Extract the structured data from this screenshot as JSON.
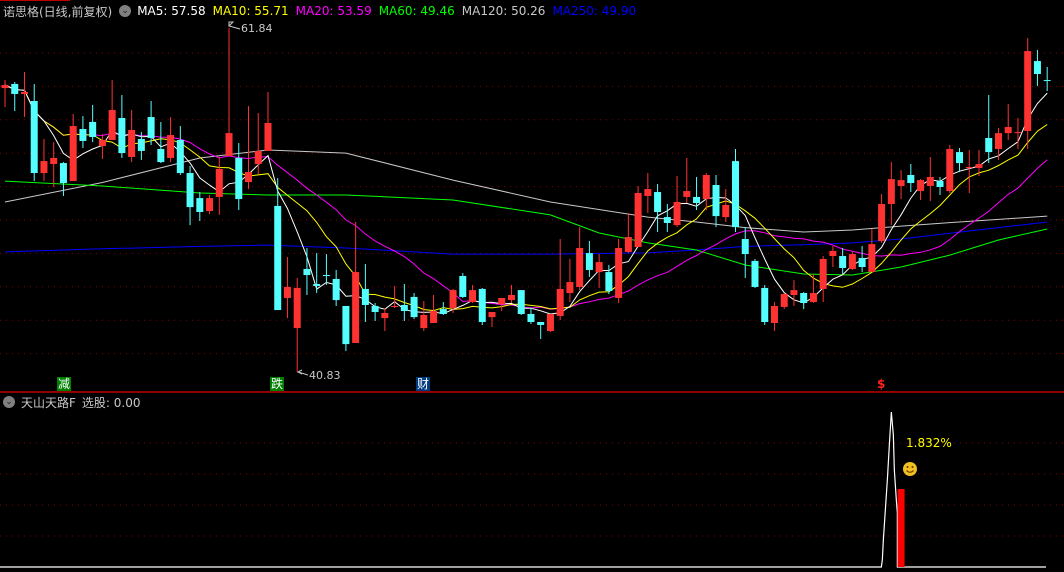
{
  "header": {
    "title": "诺思格(日线,前复权)",
    "ma": [
      {
        "label": "MA5: 57.58",
        "color": "#ffffff"
      },
      {
        "label": "MA10: 55.71",
        "color": "#ffff00"
      },
      {
        "label": "MA20: 53.59",
        "color": "#ff00ff"
      },
      {
        "label": "MA60: 49.46",
        "color": "#00ff00"
      },
      {
        "label": "MA120: 50.26",
        "color": "#c8c8c8"
      },
      {
        "label": "MA250: 49.90",
        "color": "#0000ff"
      }
    ]
  },
  "indicator": {
    "name": "天山天路F",
    "value_label": "选股: 0.00",
    "pct_label": "1.832%",
    "smiley": "smiley-icon"
  },
  "markers": [
    {
      "text": "减",
      "bg": "#008000"
    },
    {
      "text": "跌",
      "bg": "#008000"
    },
    {
      "text": "财",
      "bg": "#003a80"
    },
    {
      "text": "$",
      "color": "#ff2020"
    }
  ],
  "colors": {
    "up": "#ff3232",
    "down": "#54ffff",
    "grid": "#8b0000",
    "separator": "#c00000"
  },
  "chart_data": {
    "type": "candlestick",
    "title": "诺思格(日线,前复权)",
    "ylim": [
      40.0,
      62.5
    ],
    "annotations": [
      {
        "label": "61.84",
        "candle": 23,
        "type": "high"
      },
      {
        "label": "40.83",
        "candle": 30,
        "type": "low"
      }
    ],
    "ohlc": [
      [
        58.17,
        58.66,
        57.01,
        58.36
      ],
      [
        58.42,
        58.54,
        56.77,
        57.81
      ],
      [
        57.81,
        59.15,
        56.4,
        57.93
      ],
      [
        57.38,
        58.42,
        52.49,
        52.98
      ],
      [
        52.98,
        55.06,
        52.49,
        53.71
      ],
      [
        53.53,
        54.87,
        52.13,
        53.9
      ],
      [
        53.59,
        53.65,
        51.58,
        52.37
      ],
      [
        52.49,
        56.59,
        52.49,
        55.85
      ],
      [
        55.67,
        56.46,
        54.51,
        54.94
      ],
      [
        56.1,
        57.14,
        54.87,
        55.18
      ],
      [
        54.63,
        55.36,
        53.84,
        55.0
      ],
      [
        55.0,
        58.66,
        55.0,
        56.83
      ],
      [
        56.34,
        57.75,
        53.9,
        54.2
      ],
      [
        53.96,
        56.83,
        53.65,
        55.61
      ],
      [
        55.06,
        55.49,
        53.78,
        54.33
      ],
      [
        56.4,
        57.38,
        54.69,
        55.12
      ],
      [
        54.45,
        56.1,
        53.59,
        53.65
      ],
      [
        53.9,
        56.4,
        53.65,
        55.3
      ],
      [
        55.0,
        55.85,
        52.86,
        52.98
      ],
      [
        52.98,
        53.41,
        49.8,
        50.9
      ],
      [
        51.45,
        51.82,
        50.05,
        50.6
      ],
      [
        50.66,
        51.64,
        50.48,
        51.45
      ],
      [
        51.52,
        53.96,
        50.42,
        53.23
      ],
      [
        54.02,
        61.84,
        54.02,
        55.42
      ],
      [
        53.9,
        54.81,
        50.72,
        51.39
      ],
      [
        52.43,
        57.07,
        52.0,
        53.04
      ],
      [
        53.53,
        56.65,
        52.92,
        54.33
      ],
      [
        54.33,
        57.93,
        54.33,
        56.04
      ],
      [
        50.97,
        52.68,
        44.61,
        44.61
      ],
      [
        45.35,
        47.85,
        44.12,
        46.02
      ],
      [
        43.51,
        46.57,
        40.83,
        45.96
      ],
      [
        47.12,
        48.4,
        45.53,
        46.75
      ],
      [
        46.2,
        48.09,
        45.65,
        46.08
      ],
      [
        46.75,
        48.03,
        46.14,
        46.69
      ],
      [
        46.51,
        47.06,
        44.86,
        45.22
      ],
      [
        44.86,
        44.86,
        42.11,
        42.53
      ],
      [
        42.6,
        49.99,
        42.6,
        46.93
      ],
      [
        45.9,
        47.42,
        43.88,
        44.92
      ],
      [
        44.86,
        45.04,
        43.94,
        44.49
      ],
      [
        44.12,
        44.73,
        43.33,
        44.43
      ],
      [
        44.8,
        46.08,
        44.73,
        44.86
      ],
      [
        44.92,
        46.2,
        43.94,
        44.55
      ],
      [
        45.41,
        45.65,
        44.06,
        44.18
      ],
      [
        43.51,
        45.16,
        43.33,
        44.31
      ],
      [
        43.82,
        45.53,
        43.82,
        44.55
      ],
      [
        44.67,
        45.1,
        44.31,
        44.37
      ],
      [
        44.73,
        45.9,
        44.43,
        45.83
      ],
      [
        46.69,
        46.87,
        45.35,
        45.41
      ],
      [
        45.1,
        46.14,
        45.04,
        45.83
      ],
      [
        45.9,
        45.96,
        43.7,
        43.88
      ],
      [
        44.18,
        44.49,
        43.57,
        44.49
      ],
      [
        44.98,
        45.35,
        44.55,
        45.35
      ],
      [
        45.22,
        46.14,
        45.04,
        45.53
      ],
      [
        45.83,
        45.83,
        44.31,
        44.37
      ],
      [
        44.37,
        44.73,
        43.76,
        43.88
      ],
      [
        43.88,
        43.88,
        42.84,
        43.7
      ],
      [
        43.33,
        43.57,
        43.27,
        44.37
      ],
      [
        44.25,
        48.95,
        44.0,
        45.9
      ],
      [
        45.65,
        47.73,
        45.1,
        46.32
      ],
      [
        46.02,
        49.68,
        45.83,
        48.4
      ],
      [
        48.09,
        48.83,
        46.63,
        47.06
      ],
      [
        46.93,
        48.03,
        45.96,
        47.54
      ],
      [
        46.93,
        47.36,
        45.59,
        45.77
      ],
      [
        45.35,
        48.95,
        45.04,
        48.4
      ],
      [
        48.16,
        50.54,
        48.09,
        49.07
      ],
      [
        48.46,
        52.19,
        48.46,
        51.76
      ],
      [
        51.58,
        52.98,
        50.54,
        52.0
      ],
      [
        51.82,
        52.31,
        49.38,
        50.6
      ],
      [
        50.29,
        51.09,
        49.38,
        49.93
      ],
      [
        49.8,
        52.8,
        49.68,
        51.21
      ],
      [
        51.52,
        53.9,
        51.15,
        51.88
      ],
      [
        51.52,
        52.74,
        50.72,
        51.15
      ],
      [
        51.39,
        52.98,
        50.72,
        52.86
      ],
      [
        52.25,
        52.86,
        49.68,
        50.35
      ],
      [
        50.29,
        52.0,
        49.99,
        51.03
      ],
      [
        53.71,
        54.45,
        49.38,
        49.68
      ],
      [
        48.95,
        49.68,
        46.57,
        48.03
      ],
      [
        47.61,
        47.73,
        45.96,
        46.02
      ],
      [
        45.96,
        46.14,
        43.7,
        43.88
      ],
      [
        43.82,
        45.1,
        43.33,
        44.86
      ],
      [
        44.8,
        45.65,
        44.67,
        45.59
      ],
      [
        45.53,
        46.44,
        44.86,
        45.83
      ],
      [
        45.65,
        45.71,
        44.67,
        45.04
      ],
      [
        45.1,
        46.81,
        45.04,
        45.65
      ],
      [
        45.9,
        47.91,
        45.1,
        47.73
      ],
      [
        47.91,
        48.52,
        47.24,
        48.22
      ],
      [
        47.91,
        48.4,
        46.81,
        47.18
      ],
      [
        47.12,
        48.16,
        47.06,
        48.03
      ],
      [
        47.79,
        48.52,
        46.93,
        47.24
      ],
      [
        46.93,
        49.56,
        46.93,
        48.64
      ],
      [
        48.83,
        51.7,
        48.71,
        51.09
      ],
      [
        51.09,
        53.65,
        49.8,
        52.61
      ],
      [
        52.19,
        53.16,
        51.39,
        52.55
      ],
      [
        52.86,
        53.53,
        51.82,
        52.37
      ],
      [
        51.88,
        52.61,
        51.33,
        52.55
      ],
      [
        52.19,
        53.96,
        51.27,
        52.74
      ],
      [
        52.49,
        52.74,
        51.64,
        52.13
      ],
      [
        51.88,
        54.69,
        51.76,
        54.45
      ],
      [
        54.26,
        54.51,
        53.04,
        53.59
      ],
      [
        53.29,
        54.39,
        51.76,
        53.35
      ],
      [
        53.29,
        54.39,
        52.8,
        53.53
      ],
      [
        55.12,
        57.75,
        53.59,
        54.26
      ],
      [
        54.45,
        55.73,
        53.78,
        55.42
      ],
      [
        55.42,
        57.2,
        55.0,
        55.79
      ],
      [
        55.42,
        56.34,
        54.45,
        55.48
      ],
      [
        55.55,
        61.23,
        54.45,
        60.43
      ],
      [
        59.82,
        60.5,
        58.3,
        59.03
      ],
      [
        58.66,
        59.46,
        57.99,
        58.6
      ]
    ],
    "long_ma": {
      "MA60": [
        [
          0,
          52.49
        ],
        [
          10,
          52.19
        ],
        [
          20,
          51.76
        ],
        [
          27,
          51.64
        ],
        [
          35,
          51.64
        ],
        [
          46,
          51.33
        ],
        [
          56,
          50.42
        ],
        [
          61,
          49.32
        ],
        [
          66,
          48.71
        ],
        [
          71,
          48.28
        ],
        [
          76,
          47.36
        ],
        [
          82,
          46.81
        ],
        [
          87,
          46.75
        ],
        [
          92,
          47.24
        ],
        [
          97,
          47.97
        ],
        [
          102,
          48.89
        ],
        [
          107,
          49.56
        ]
      ],
      "MA120": [
        [
          0,
          51.21
        ],
        [
          10,
          52.4
        ],
        [
          20,
          53.9
        ],
        [
          27,
          54.39
        ],
        [
          35,
          54.2
        ],
        [
          46,
          52.55
        ],
        [
          56,
          51.21
        ],
        [
          66,
          50.29
        ],
        [
          71,
          49.99
        ],
        [
          76,
          49.65
        ],
        [
          82,
          49.38
        ],
        [
          87,
          49.5
        ],
        [
          92,
          49.74
        ],
        [
          97,
          49.95
        ],
        [
          102,
          50.15
        ],
        [
          107,
          50.35
        ]
      ],
      "MA250": [
        [
          0,
          48.16
        ],
        [
          10,
          48.35
        ],
        [
          20,
          48.5
        ],
        [
          27,
          48.58
        ],
        [
          35,
          48.4
        ],
        [
          46,
          48.03
        ],
        [
          56,
          48.03
        ],
        [
          66,
          48.1
        ],
        [
          71,
          48.28
        ],
        [
          76,
          48.5
        ],
        [
          82,
          48.6
        ],
        [
          87,
          48.71
        ],
        [
          92,
          48.95
        ],
        [
          97,
          49.3
        ],
        [
          102,
          49.65
        ],
        [
          107,
          49.99
        ]
      ]
    },
    "indicator_series": {
      "name": "天山天路F",
      "spike_candle": 91,
      "bar_candle": 92,
      "bar_fraction": 0.5
    }
  }
}
